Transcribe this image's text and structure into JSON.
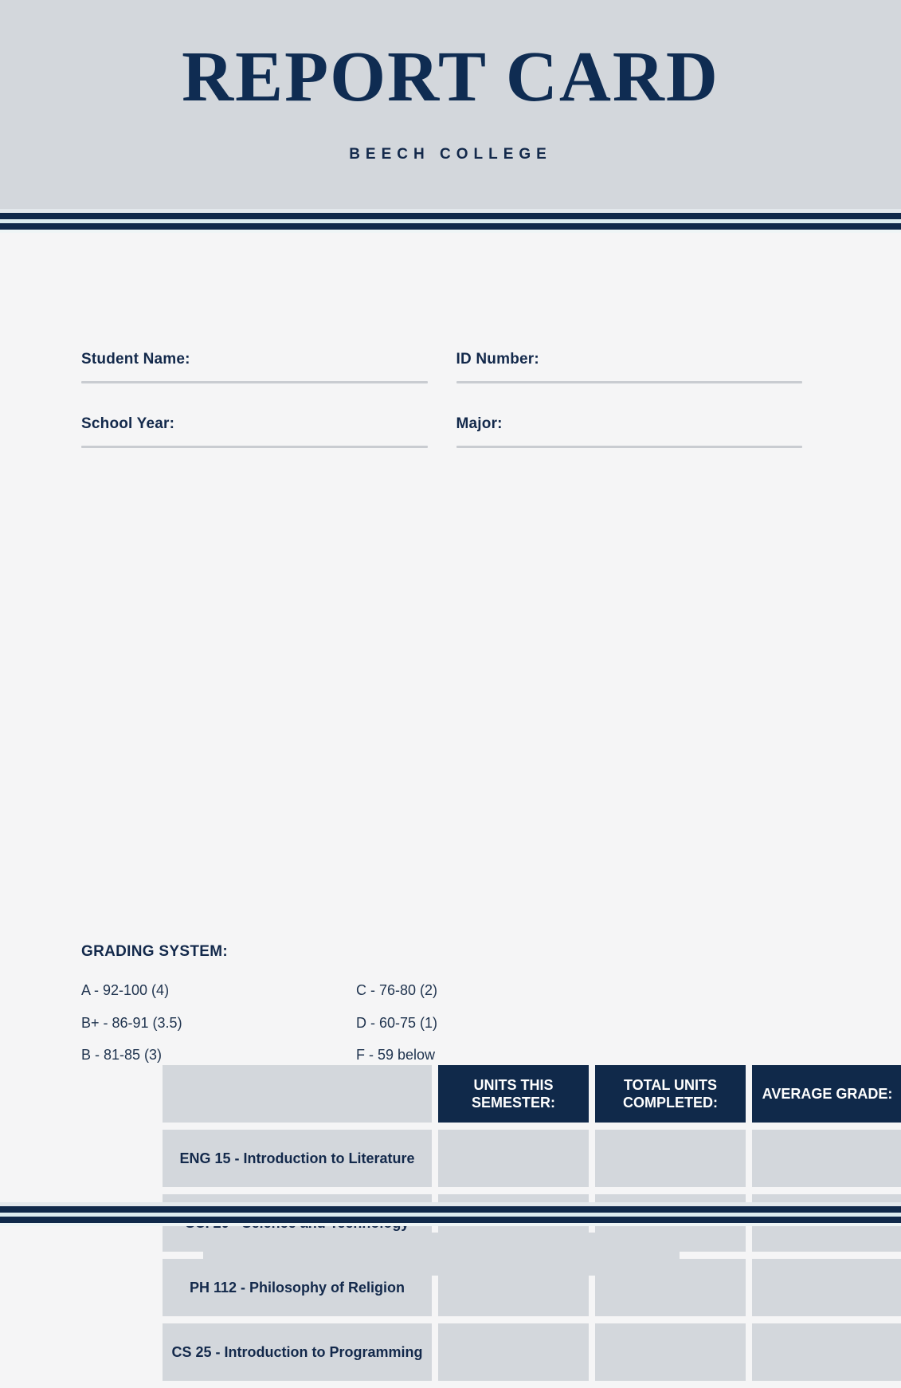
{
  "header": {
    "title": "REPORT CARD",
    "college": "BEECH COLLEGE"
  },
  "student_info": {
    "fields": [
      {
        "label": "Student Name:",
        "value": ""
      },
      {
        "label": "ID Number:",
        "value": ""
      },
      {
        "label": "School Year:",
        "value": ""
      },
      {
        "label": "Major:",
        "value": ""
      }
    ]
  },
  "grade_table": {
    "corner_label": "",
    "columns": [
      "UNITS THIS SEMESTER:",
      "TOTAL UNITS COMPLETED:",
      "AVERAGE GRADE:"
    ],
    "rows": [
      {
        "course": "ENG 15 - Introduction to Literature",
        "units_this_semester": "",
        "total_units_completed": "",
        "average_grade": ""
      },
      {
        "course": "SCI 20 - Science and Technology",
        "units_this_semester": "",
        "total_units_completed": "",
        "average_grade": ""
      },
      {
        "course": "PH 112 - Philosophy of Religion",
        "units_this_semester": "",
        "total_units_completed": "",
        "average_grade": ""
      },
      {
        "course": "CS 25 - Introduction to Programming",
        "units_this_semester": "",
        "total_units_completed": "",
        "average_grade": ""
      }
    ]
  },
  "grading_system": {
    "title": "GRADING SYSTEM:",
    "left_column": [
      "A - 92-100 (4)",
      "B+ - 86-91 (3.5)",
      "B - 81-85 (3)"
    ],
    "right_column": [
      "C - 76-80 (2)",
      "D - 60-75 (1)",
      "F - 59 below"
    ]
  },
  "colors": {
    "navy": "#10294a",
    "title_navy": "#0f2c52",
    "panel_gray": "#d3d7dc",
    "page_background": "#f5f5f6",
    "rule_gray": "#c9ccd1"
  }
}
